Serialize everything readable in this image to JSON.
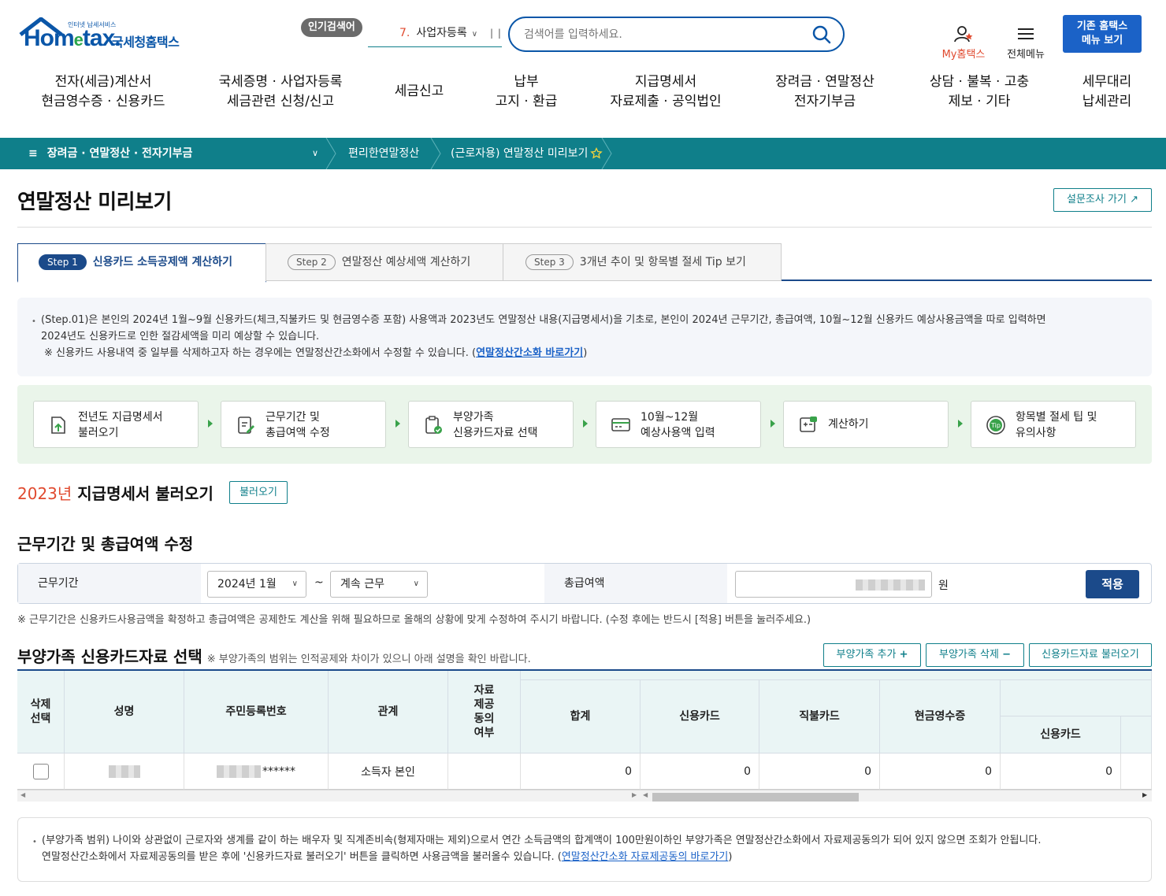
{
  "header": {
    "logo_small": "인터넷 납세서비스",
    "logo_brand_a": "Hom",
    "logo_brand_e": "e",
    "logo_brand_b": "tax.",
    "logo_name": "국세청홈택스",
    "popular_badge": "인기검색어",
    "popular_num": "7.",
    "popular_word": "사업자등록",
    "search_placeholder": "검색어를 입력하세요.",
    "my_hometax": "My홈택스",
    "all_menu": "전체메뉴",
    "old_menu_line1": "기존 홈택스",
    "old_menu_line2": "메뉴 보기"
  },
  "gnb": [
    {
      "l1": "전자(세금)계산서",
      "l2": "현금영수증 · 신용카드"
    },
    {
      "l1": "국세증명 · 사업자등록",
      "l2": "세금관련 신청/신고"
    },
    {
      "l1": "세금신고",
      "l2": ""
    },
    {
      "l1": "납부",
      "l2": "고지 · 환급"
    },
    {
      "l1": "지급명세서",
      "l2": "자료제출 · 공익법인"
    },
    {
      "l1": "장려금 · 연말정산",
      "l2": "전자기부금"
    },
    {
      "l1": "상담 · 불복 · 고충",
      "l2": "제보 · 기타"
    },
    {
      "l1": "세무대리",
      "l2": "납세관리"
    }
  ],
  "breadcrumb": {
    "menu": "장려금 · 연말정산 · 전자기부금",
    "item1": "편리한연말정산",
    "item2": "(근로자용) 연말정산 미리보기"
  },
  "page": {
    "title": "연말정산 미리보기",
    "survey": "설문조사 가기"
  },
  "tabs": [
    {
      "step": "Step 1",
      "label": "신용카드 소득공제액 계산하기"
    },
    {
      "step": "Step 2",
      "label": "연말정산 예상세액 계산하기"
    },
    {
      "step": "Step 3",
      "label": "3개년 추이 및 항목별 절세 Tip 보기"
    }
  ],
  "info": {
    "line1": "(Step.01)은 본인의 2024년 1월~9월 신용카드(체크,직불카드 및 현금영수증 포함) 사용액과 2023년도 연말정산 내용(지급명세서)을 기초로, 본인이 2024년 근무기간, 총급여액, 10월~12월 신용카드 예상사용금액을 따로 입력하면",
    "line2": "2024년도 신용카드로 인한 절감세액을 미리 예상할 수 있습니다.",
    "line3_pre": "※ 신용카드 사용내역 중 일부를 삭제하고자 하는 경우에는 연말정산간소화에서 수정할 수 있습니다. (",
    "line3_link": "연말정산간소화 바로가기",
    "line3_post": ")"
  },
  "steps": [
    {
      "l1": "전년도 지급명세서",
      "l2": "불러오기"
    },
    {
      "l1": "근무기간 및",
      "l2": "총급여액 수정"
    },
    {
      "l1": "부양가족",
      "l2": "신용카드자료 선택"
    },
    {
      "l1": "10월~12월",
      "l2": "예상사용액 입력"
    },
    {
      "l1": "계산하기",
      "l2": ""
    },
    {
      "l1": "항목별 절세 팁 및",
      "l2": "유의사항"
    }
  ],
  "section1": {
    "year": "2023년",
    "title": "지급명세서 불러오기",
    "button": "불러오기"
  },
  "section2": {
    "title": "근무기간 및 총급여액 수정",
    "period_label": "근무기간",
    "period_start": "2024년 1월",
    "tilde": "~",
    "period_end": "계속 근무",
    "salary_label": "총급여액",
    "unit": "원",
    "apply": "적용",
    "note": "※ 근무기간은 신용카드사용금액을 확정하고 총급여액은 공제한도 계산을 위해 필요하므로 올해의 상황에 맞게 수정하여 주시기 바랍니다. (수정 후에는 반드시 [적용] 버튼을 눌러주세요.)"
  },
  "section3": {
    "title": "부양가족 신용카드자료 선택",
    "subtitle": "※ 부양가족의 범위는 인적공제와 차이가 있으니 아래 설명을 확인 바랍니다.",
    "btn_add": "부양가족 추가",
    "btn_add_sym": "+",
    "btn_del": "부양가족 삭제",
    "btn_del_sym": "−",
    "btn_load": "신용카드자료 불러오기"
  },
  "table": {
    "headers": {
      "del": "삭제 선택",
      "name": "성명",
      "rrn": "주민등록번호",
      "rel": "관계",
      "consent": "자료 제공 동의 여부",
      "total": "합계",
      "credit": "신용카드",
      "debit": "직불카드",
      "cash": "현금영수증",
      "sub_credit": "신용카드"
    },
    "row": {
      "rrn_mask": "******",
      "relation": "소득자 본인",
      "total": "0",
      "credit": "0",
      "debit": "0",
      "cash": "0",
      "sub_credit": "0"
    }
  },
  "notice": {
    "line1": "(부양가족 범위) 나이와 상관없이 근로자와 생계를 같이 하는 배우자 및 직계존비속(형제자매는 제외)으로서 연간 소득금액의 합계액이 100만원이하인 부양가족은 연말정산간소화에서 자료제공동의가 되어 있지 않으면 조회가 안됩니다.",
    "line2_pre": "연말정산간소화에서 자료제공동의를 받은 후에 '신용카드자료 불러오기' 버튼을 클릭하면 사용금액을 불러올수 있습니다. (",
    "line2_link": "연말정산간소화 자료제공동의 바로가기",
    "line2_post": ")"
  },
  "colors": {
    "teal": "#0f7f8a",
    "navy": "#1b4a8a",
    "blue": "#1b62c7",
    "red": "#e04a2f",
    "green": "#39a24a"
  }
}
